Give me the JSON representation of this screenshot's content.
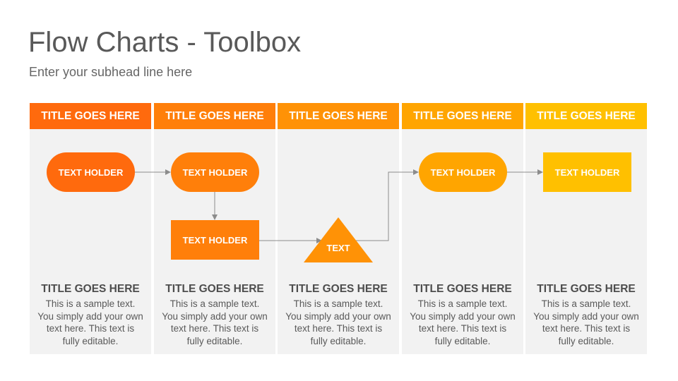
{
  "header": {
    "title": "Flow Charts - Toolbox",
    "subtitle": "Enter your subhead line here"
  },
  "colors": {
    "col1": "#FF6A0D",
    "col2": "#FF7F0A",
    "col3": "#FF9206",
    "col4": "#FFA500",
    "col5": "#FFC000",
    "panel": "#F2F2F2",
    "connector": "#8C8C8C"
  },
  "columns": [
    {
      "header": "TITLE GOES HERE",
      "title": "TITLE GOES HERE",
      "description": "This is a sample text. You simply add your own text here. This text is fully editable."
    },
    {
      "header": "TITLE GOES HERE",
      "title": "TITLE GOES HERE",
      "description": "This is a sample text. You simply add your own text here. This text is fully editable."
    },
    {
      "header": "TITLE GOES HERE",
      "title": "TITLE GOES HERE",
      "description": "This is a sample text. You simply add your own text here. This text is fully editable."
    },
    {
      "header": "TITLE GOES HERE",
      "title": "TITLE GOES HERE",
      "description": "This is a sample text. You simply add your own text here. This text is fully editable."
    },
    {
      "header": "TITLE GOES HERE",
      "title": "TITLE GOES HERE",
      "description": "This is a sample text. You simply add your own text here. This text is fully editable."
    }
  ],
  "nodes": {
    "start": "TEXT HOLDER",
    "step2": "TEXT HOLDER",
    "process": "TEXT HOLDER",
    "decision": "TEXT",
    "step4": "TEXT HOLDER",
    "end": "TEXT HOLDER"
  }
}
